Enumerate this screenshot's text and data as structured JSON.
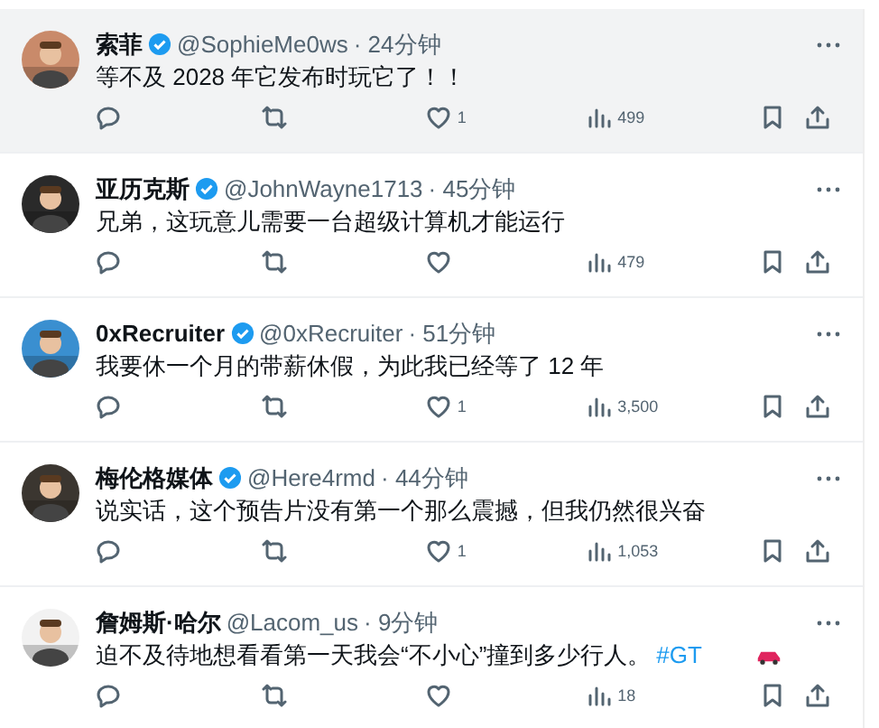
{
  "tweets": [
    {
      "name": "索菲",
      "verified": true,
      "handle": "@SophieMe0ws",
      "time": "· 24分钟",
      "text": "等不及 2028 年它发布时玩它了！！",
      "car": false,
      "likes": "1",
      "views": "499",
      "highlighted": true
    },
    {
      "name": "亚历克斯",
      "verified": true,
      "handle": "@JohnWayne1713",
      "time": "· 45分钟",
      "text": "兄弟，这玩意儿需要一台超级计算机才能运行",
      "car": false,
      "views": "479",
      "highlighted": false
    },
    {
      "name": "0xRecruiter",
      "verified": true,
      "handle": "@0xRecruiter",
      "time": "· 51分钟",
      "text": "我要休一个月的带薪休假，为此我已经等了 12 年",
      "car": false,
      "likes": "1",
      "views": "3,500",
      "highlighted": false
    },
    {
      "name": "梅伦格媒体",
      "verified": true,
      "handle": "@Here4rmd",
      "time": "· 44分钟",
      "text": "说实话，这个预告片没有第一个那么震撼，但我仍然很兴奋",
      "car": false,
      "likes": "1",
      "views": "1,053",
      "highlighted": false
    },
    {
      "name": "詹姆斯·哈尔",
      "verified": false,
      "handle": "@Lacom_us",
      "time": "· 9分钟",
      "text": "迫不及待地想看看第一天我会“不小心”撞到多少行人。",
      "hashtag": "#GT",
      "car": true,
      "views": "18",
      "highlighted": false
    }
  ]
}
